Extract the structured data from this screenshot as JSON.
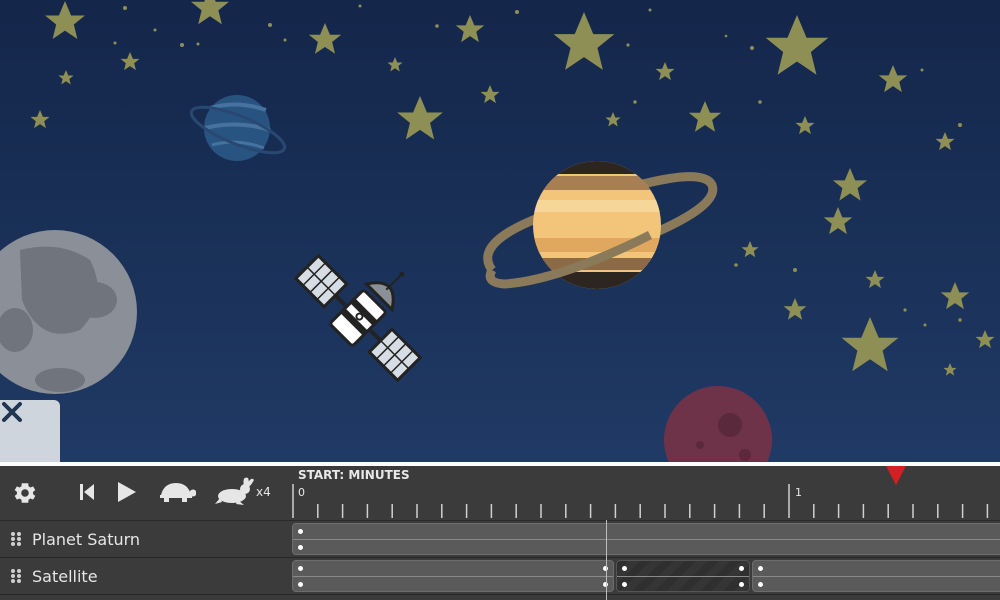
{
  "scene": {
    "close_icon": "close-icon",
    "colors": {
      "sky_top": "#14264a",
      "sky_bottom": "#203a66",
      "star": "#8e8f55",
      "saturn_body": "#f2c57a",
      "saturn_ring": "#8a7a5a",
      "moon": "#8a8f98",
      "red_planet": "#6e3349",
      "blue_planet": "#2c5b8a"
    }
  },
  "toolbar": {
    "settings_icon": "gear-icon",
    "rewind_icon": "skip-back-icon",
    "play_icon": "play-icon",
    "slow_icon": "turtle-icon",
    "fast_icon": "rabbit-icon",
    "speed_multiplier": "x4"
  },
  "ruler": {
    "title": "START: MINUTES",
    "labels": [
      "0",
      "1"
    ],
    "playhead_icon": "playhead-marker-icon"
  },
  "tracks": [
    {
      "name": "Planet Saturn"
    },
    {
      "name": "Satellite"
    }
  ],
  "accent_colors": {
    "playhead": "#d42020",
    "panel": "#3b3b3b"
  }
}
